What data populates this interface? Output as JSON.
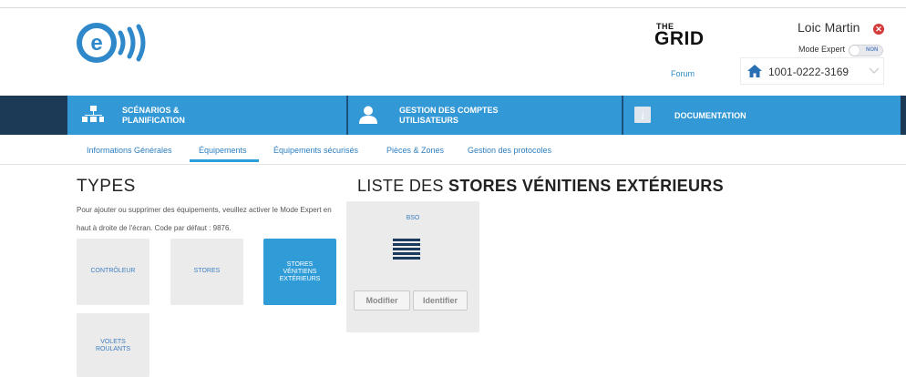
{
  "header": {
    "grid_the": "THE",
    "grid_name": "GRID",
    "forum_link": "Forum",
    "user_name": "Loic Martin",
    "expert_mode_label": "Mode Expert",
    "expert_toggle_state": "NON",
    "site_selector_value": "1001-0222-3169"
  },
  "navbar": {
    "items": [
      {
        "label_line1": "SCÉNARIOS &",
        "label_line2": "PLANIFICATION",
        "icon": "scenario-network-icon"
      },
      {
        "label_line1": "GESTION DES COMPTES",
        "label_line2": "UTILISATEURS",
        "icon": "user-icon"
      },
      {
        "label_line1": "DOCUMENTATION",
        "label_line2": "",
        "icon": "info-icon"
      }
    ]
  },
  "subtabs": {
    "items": [
      "Informations Générales",
      "Équipements",
      "Équipements sécurisés",
      "Pièces & Zones",
      "Gestion des protocoles"
    ],
    "active": "Équipements"
  },
  "types": {
    "title": "TYPES",
    "help_text": "Pour ajouter ou supprimer des équipements, veuillez activer le Mode Expert en haut à droite de l'écran. Code par défaut : 9876.",
    "tiles": [
      {
        "line1": "CONTRÔLEUR",
        "line2": "",
        "line3": ""
      },
      {
        "line1": "STORES",
        "line2": "",
        "line3": ""
      },
      {
        "line1": "STORES",
        "line2": "VÉNITIENS",
        "line3": "EXTÉRIEURS"
      },
      {
        "line1": "VOLETS",
        "line2": "ROULANTS",
        "line3": ""
      }
    ],
    "active_tile": "STORES VÉNITIENS EXTÉRIEURS"
  },
  "list": {
    "title_prefix": "LISTE DES",
    "title_bold": "STORES VÉNITIENS EXTÉRIEURS",
    "devices": [
      {
        "name": "BSO",
        "modify_label": "Modifier",
        "identify_label": "Identifier"
      }
    ]
  },
  "colors": {
    "nav_blue": "#3398d6",
    "nav_dark": "#1c3956",
    "link_blue": "#2d7fc0",
    "close_red": "#d33a3a"
  }
}
